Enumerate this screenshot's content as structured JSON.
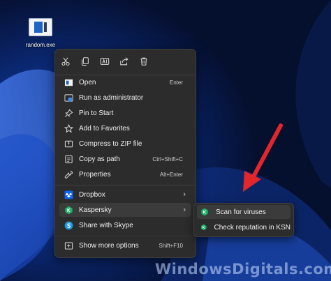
{
  "desktop": {
    "icon_label": "random.exe"
  },
  "toolbar": {
    "buttons": [
      {
        "name": "cut",
        "icon": "scissors-icon"
      },
      {
        "name": "copy",
        "icon": "copy-icon"
      },
      {
        "name": "rename",
        "icon": "rename-icon"
      },
      {
        "name": "share",
        "icon": "share-icon"
      },
      {
        "name": "delete",
        "icon": "trash-icon"
      }
    ]
  },
  "menu": {
    "open": {
      "label": "Open",
      "shortcut": "Enter"
    },
    "run_admin": {
      "label": "Run as administrator"
    },
    "pin_start": {
      "label": "Pin to Start"
    },
    "favorites": {
      "label": "Add to Favorites"
    },
    "compress": {
      "label": "Compress to ZIP file"
    },
    "copy_path": {
      "label": "Copy as path",
      "shortcut": "Ctrl+Shift+C"
    },
    "properties": {
      "label": "Properties",
      "shortcut": "Alt+Enter"
    },
    "dropbox": {
      "label": "Dropbox"
    },
    "kaspersky": {
      "label": "Kaspersky"
    },
    "skype": {
      "label": "Share with Skype"
    },
    "more_options": {
      "label": "Show more options",
      "shortcut": "Shift+F10"
    }
  },
  "submenu": {
    "scan": {
      "label": "Scan for viruses"
    },
    "check_ksn": {
      "label": "Check reputation in KSN"
    }
  },
  "watermark": {
    "text": "WindowsDigitals.com"
  },
  "colors": {
    "menu_bg": "#2c2c2c",
    "hover_bg": "#3b3b3b",
    "arrow": "#e3262b",
    "kaspersky_green": "#1fb369",
    "dropbox_blue": "#0d62f0",
    "skype_blue": "#1c9be8"
  }
}
